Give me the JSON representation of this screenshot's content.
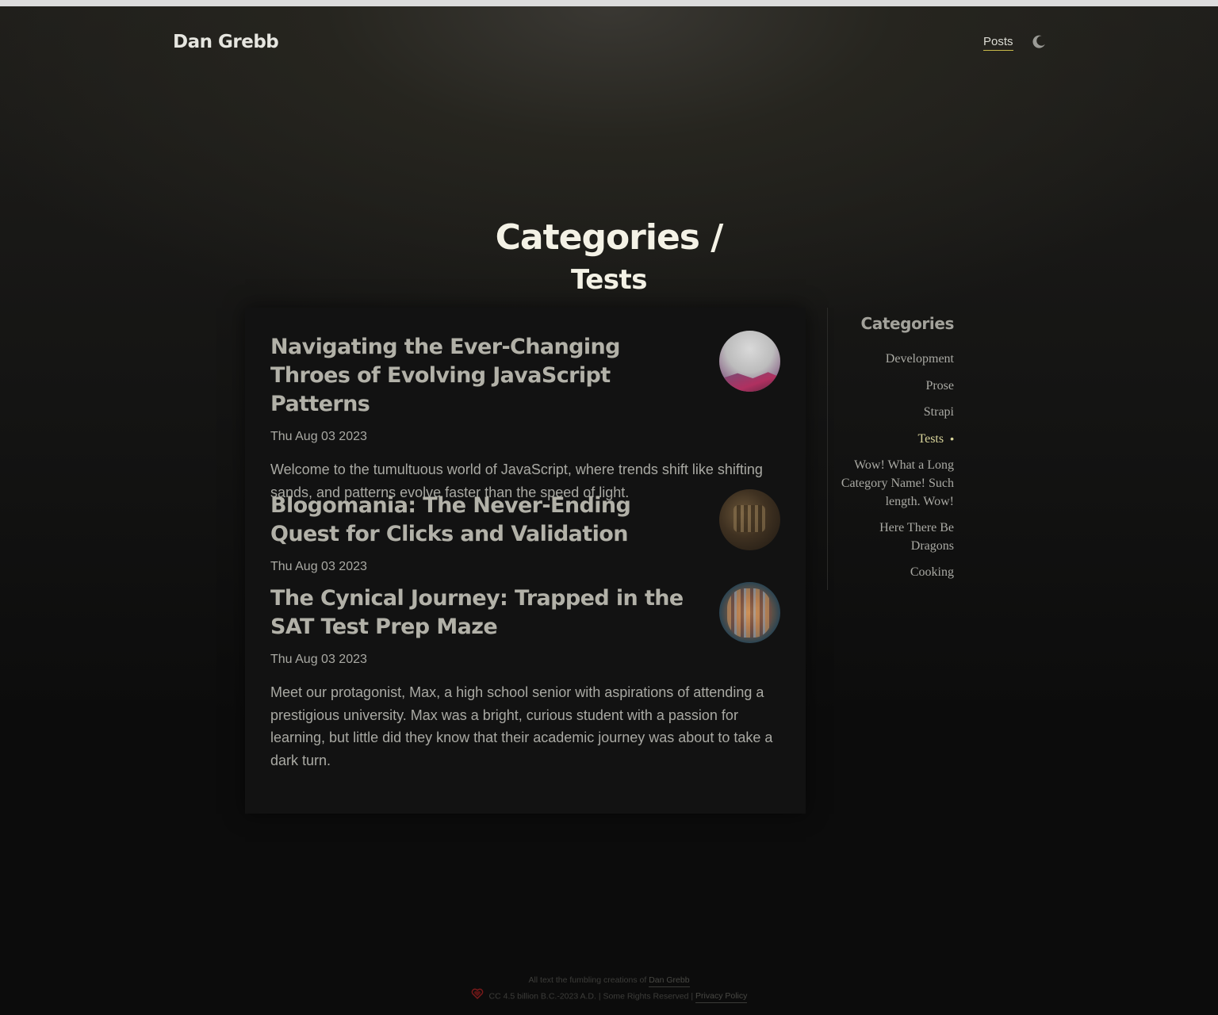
{
  "site": {
    "title": "Dan Grebb"
  },
  "nav": {
    "posts_label": "Posts",
    "theme_icon": "moon-icon"
  },
  "heading": {
    "line1": "Categories /",
    "line2": "Tests"
  },
  "posts": [
    {
      "title": "Navigating the Ever-Changing Throes of Evolving JavaScript Patterns",
      "date": "Thu Aug 03 2023",
      "excerpt": "Welcome to the tumultuous world of JavaScript, where trends shift like shifting sands, and patterns evolve faster than the speed of light."
    },
    {
      "title": "Blogomania: The Never-Ending Quest for Clicks and Validation",
      "date": "Thu Aug 03 2023",
      "excerpt": ""
    },
    {
      "title": "The Cynical Journey: Trapped in the SAT Test Prep Maze",
      "date": "Thu Aug 03 2023",
      "excerpt": "Meet our protagonist, Max, a high school senior with aspirations of attending a prestigious university. Max was a bright, curious student with a passion for learning, but little did they know that their academic journey was about to take a dark turn."
    }
  ],
  "sidebar": {
    "title": "Categories",
    "categories": [
      {
        "label": "Development"
      },
      {
        "label": "Prose"
      },
      {
        "label": "Strapi"
      },
      {
        "label": "Tests",
        "active": true,
        "marker": "•"
      },
      {
        "label": "Wow! What a Long Category Name! Such length. Wow!"
      },
      {
        "label": "Here There Be Dragons"
      },
      {
        "label": "Cooking"
      }
    ]
  },
  "footer": {
    "line1_prefix": "All text the fumbling creations of",
    "author_link": "Dan Grebb",
    "license_text": "CC 4.5 billion B.C.-2023 A.D. | Some Rights Reserved |",
    "privacy_link": "Privacy Policy",
    "heart_color": "#7a1a1a"
  },
  "colors": {
    "accent": "#d8d49a",
    "underline": "#c9b94a",
    "background": "#0c0c0c",
    "panel": "#121212"
  }
}
